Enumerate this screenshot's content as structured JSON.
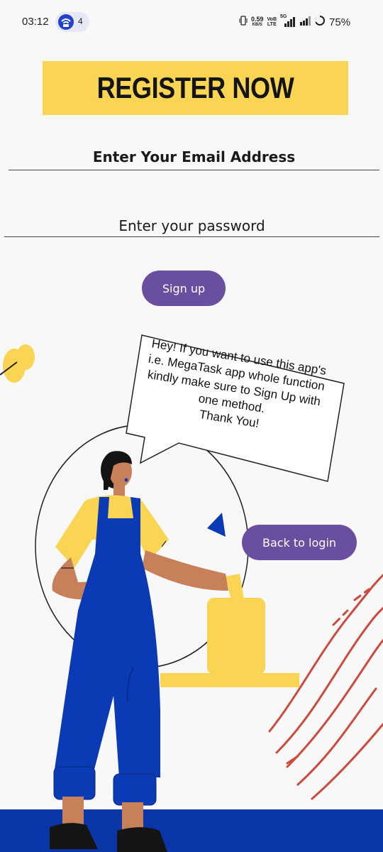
{
  "status_bar": {
    "time": "03:12",
    "hotspot_count": "4",
    "net_speed_value": "0.59",
    "net_speed_unit": "KB/S",
    "volte_top": "VoB",
    "volte_bottom": "LTE",
    "signal_tag": "5G",
    "battery_percent": "75%"
  },
  "banner": {
    "text": "REGISTER NOW"
  },
  "form": {
    "email_label": "Enter Your Email Address",
    "password_label": "Enter your password",
    "signup_label": "Sign up"
  },
  "speech_bubble": {
    "lines": [
      "Hey! If you want to use this app's",
      "i.e. MegaTask app whole function",
      "kindly make sure to Sign Up with",
      "one method.",
      "Thank You!"
    ]
  },
  "back_to_login": {
    "label": "Back to login"
  },
  "colors": {
    "banner_yellow": "#f9d553",
    "button_purple": "#6a4fa0",
    "overall_blue": "#0a3bb5",
    "accent_red": "#cf4a3e",
    "footer_blue": "#0a36a8"
  }
}
